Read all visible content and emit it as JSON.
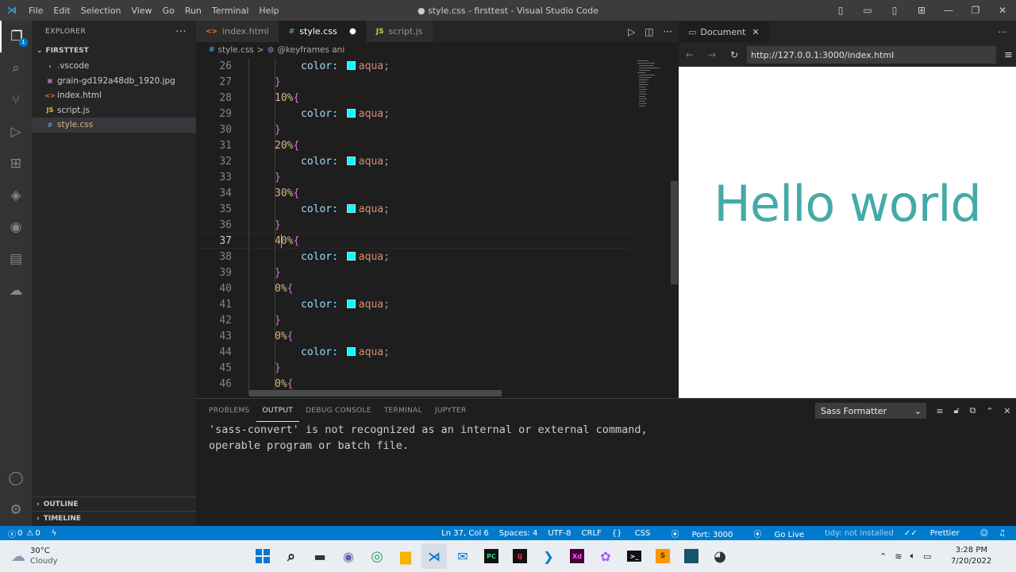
{
  "window": {
    "title": "● style.css - firsttest - Visual Studio Code",
    "menu": [
      "File",
      "Edit",
      "Selection",
      "View",
      "Go",
      "Run",
      "Terminal",
      "Help"
    ]
  },
  "sidebar": {
    "header": "EXPLORER",
    "folder": "FIRSTTEST",
    "items": [
      {
        "name": ".vscode",
        "icon": "chevron-right-icon"
      },
      {
        "name": "grain-gd192a48db_1920.jpg",
        "icon": "image-icon"
      },
      {
        "name": "index.html",
        "icon": "html-file-icon"
      },
      {
        "name": "script.js",
        "icon": "js-file-icon"
      },
      {
        "name": "style.css",
        "icon": "css-file-icon"
      }
    ],
    "outline": "OUTLINE",
    "timeline": "TIMELINE",
    "explorer_badge": "1"
  },
  "tabs": [
    {
      "label": "index.html",
      "icon": "<>",
      "active": false
    },
    {
      "label": "style.css",
      "icon": "#",
      "active": true,
      "dirty": "●"
    },
    {
      "label": "script.js",
      "icon": "JS",
      "active": false
    }
  ],
  "breadcrumb": {
    "file": "style.css",
    "sep": ">",
    "symbol": "@keyframes ani"
  },
  "code": {
    "current_line": 37,
    "lines": [
      {
        "n": "26",
        "indent": 2,
        "type": "prop",
        "prop": "color:",
        "val": "aqua;"
      },
      {
        "n": "27",
        "indent": 1,
        "type": "close",
        "text": "}"
      },
      {
        "n": "28",
        "indent": 1,
        "type": "sel",
        "text": "10%"
      },
      {
        "n": "29",
        "indent": 2,
        "type": "prop",
        "prop": "color:",
        "val": "aqua;"
      },
      {
        "n": "30",
        "indent": 1,
        "type": "close",
        "text": "}"
      },
      {
        "n": "31",
        "indent": 1,
        "type": "sel",
        "text": "20%"
      },
      {
        "n": "32",
        "indent": 2,
        "type": "prop",
        "prop": "color:",
        "val": "aqua;"
      },
      {
        "n": "33",
        "indent": 1,
        "type": "close",
        "text": "}"
      },
      {
        "n": "34",
        "indent": 1,
        "type": "sel",
        "text": "30%"
      },
      {
        "n": "35",
        "indent": 2,
        "type": "prop",
        "prop": "color:",
        "val": "aqua;"
      },
      {
        "n": "36",
        "indent": 1,
        "type": "close",
        "text": "}"
      },
      {
        "n": "37",
        "indent": 1,
        "type": "sel",
        "text": "40%"
      },
      {
        "n": "38",
        "indent": 2,
        "type": "prop",
        "prop": "color:",
        "val": "aqua;"
      },
      {
        "n": "39",
        "indent": 1,
        "type": "close",
        "text": "}"
      },
      {
        "n": "40",
        "indent": 1,
        "type": "sel",
        "text": "0%"
      },
      {
        "n": "41",
        "indent": 2,
        "type": "prop",
        "prop": "color:",
        "val": "aqua;"
      },
      {
        "n": "42",
        "indent": 1,
        "type": "close",
        "text": "}"
      },
      {
        "n": "43",
        "indent": 1,
        "type": "sel",
        "text": "0%"
      },
      {
        "n": "44",
        "indent": 2,
        "type": "prop",
        "prop": "color:",
        "val": "aqua;"
      },
      {
        "n": "45",
        "indent": 1,
        "type": "close",
        "text": "}"
      },
      {
        "n": "46",
        "indent": 1,
        "type": "sel",
        "text": "0%"
      }
    ],
    "swatch_color": "#00ffff"
  },
  "preview": {
    "tab": "Document",
    "url": "http://127.0.0.1:3000/index.html",
    "heading": "Hello world",
    "heading_color": "#44aaa8"
  },
  "panel": {
    "tabs": [
      "PROBLEMS",
      "OUTPUT",
      "DEBUG CONSOLE",
      "TERMINAL",
      "JUPYTER"
    ],
    "active_tab": "OUTPUT",
    "formatter": "Sass Formatter",
    "output": [
      "'sass-convert' is not recognized as an internal or external command,",
      "operable program or batch file."
    ]
  },
  "status": {
    "errors": "0",
    "warnings": "0",
    "position": "Ln 37, Col 6",
    "spaces": "Spaces: 4",
    "encoding": "UTF-8",
    "eol": "CRLF",
    "language": "CSS",
    "port": "Port: 3000",
    "golive": "Go Live",
    "tidy": "tidy: not installed",
    "prettier": "Prettier"
  },
  "taskbar": {
    "temp": "30°C",
    "weather": "Cloudy",
    "time": "3:28 PM",
    "date": "7/20/2022"
  }
}
